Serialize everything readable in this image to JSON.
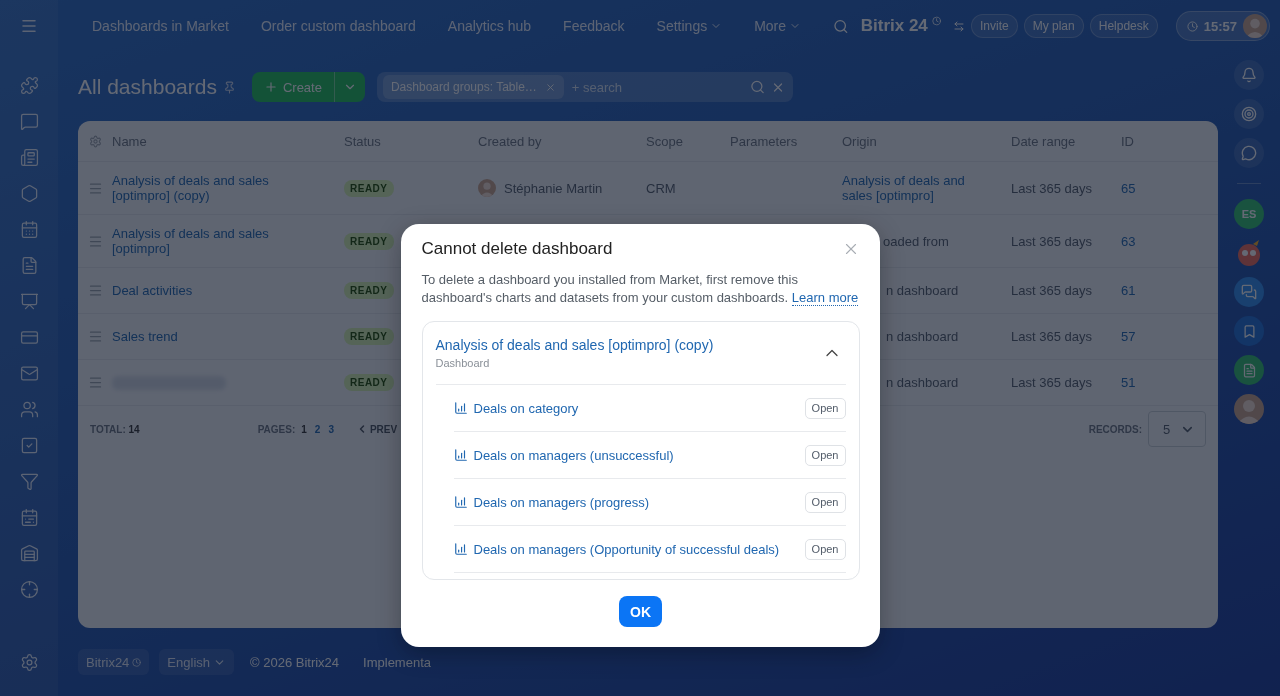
{
  "top_menu": [
    {
      "label": "Dashboards in Market",
      "dropdown": false
    },
    {
      "label": "Order custom dashboard",
      "dropdown": false
    },
    {
      "label": "Analytics hub",
      "dropdown": false
    },
    {
      "label": "Feedback",
      "dropdown": false
    },
    {
      "label": "Settings",
      "dropdown": true
    },
    {
      "label": "More",
      "dropdown": true
    }
  ],
  "logo": "Bitrix 24",
  "header_buttons": [
    "Invite",
    "My plan",
    "Helpdesk"
  ],
  "clock": "15:57",
  "page_title": "All dashboards",
  "create_button": "Create",
  "filter": {
    "chip": "Dashboard groups: Table…",
    "placeholder": "+ search"
  },
  "table": {
    "columns": [
      "Name",
      "Status",
      "Created by",
      "Scope",
      "Parameters",
      "Origin",
      "Date range",
      "ID"
    ],
    "rows": [
      {
        "name": "Analysis of deals and sales [optimpro] (copy)",
        "redacted": false,
        "status": "READY",
        "created_by": "Stéphanie Martin",
        "scope": "CRM",
        "origin": {
          "kind": "link",
          "text": "Analysis of deals and sales [optimpro]"
        },
        "date_range": "Last 365 days",
        "id": "65"
      },
      {
        "name": "Analysis of deals and sales [optimpro]",
        "redacted": false,
        "status": "READY",
        "origin": {
          "kind": "text",
          "text": "oaded from"
        },
        "date_range": "Last 365 days",
        "id": "63"
      },
      {
        "name": "Deal activities",
        "redacted": false,
        "status": "READY",
        "origin": {
          "kind": "text",
          "text": "n dashboard"
        },
        "date_range": "Last 365 days",
        "id": "61"
      },
      {
        "name": "Sales trend",
        "redacted": false,
        "status": "READY",
        "origin": {
          "kind": "text",
          "text": "n dashboard"
        },
        "date_range": "Last 365 days",
        "id": "57"
      },
      {
        "redacted": true,
        "status": "READY",
        "origin": {
          "kind": "text",
          "text": "n dashboard"
        },
        "date_range": "Last 365 days",
        "id": "51"
      }
    ]
  },
  "pager": {
    "total_label": "TOTAL:",
    "total": "14",
    "pages_label": "PAGES:",
    "pages": [
      {
        "label": "1",
        "selected": true
      },
      {
        "label": "2",
        "selected": false
      },
      {
        "label": "3",
        "selected": false
      }
    ],
    "prev": "PREV",
    "records_label": "RECORDS:",
    "records": "5"
  },
  "right_rail": {
    "initials": "ES"
  },
  "footer": {
    "brand": "Bitrix24",
    "language": "English",
    "copyright": "© 2026 Bitrix24",
    "link": "Implementa"
  },
  "dialog": {
    "title": "Cannot delete dashboard",
    "text": "To delete a dashboard you installed from Market, first remove this dashboard's charts and datasets from your custom dashboards.",
    "link": "Learn more",
    "group": {
      "title": "Analysis of deals and sales [optimpro] (copy)",
      "subtitle": "Dashboard",
      "expanded": true,
      "items": [
        {
          "label": "Deals on category",
          "button": "Open"
        },
        {
          "label": "Deals on managers (unsuccessful)",
          "button": "Open"
        },
        {
          "label": "Deals on managers (progress)",
          "button": "Open"
        },
        {
          "label": "Deals on managers (Opportunity of successful deals)",
          "button": "Open"
        }
      ]
    },
    "ok": "OK"
  }
}
